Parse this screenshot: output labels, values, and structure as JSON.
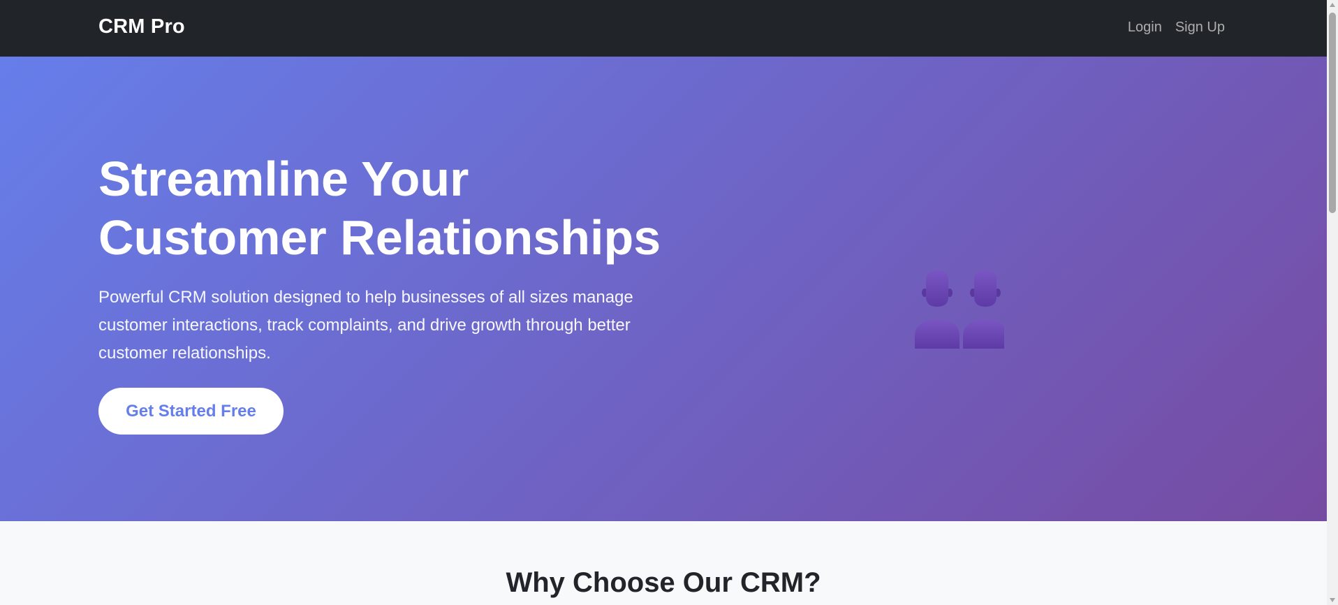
{
  "navbar": {
    "brand": "CRM Pro",
    "links": [
      "Login",
      "Sign Up"
    ]
  },
  "hero": {
    "title_line1": "Streamline Your",
    "title_line2": "Customer Relationships",
    "description": "Powerful CRM solution designed to help businesses of all sizes manage customer interactions, track complaints, and drive growth through better customer relationships.",
    "cta_label": "Get Started Free",
    "illustration": "people-icon"
  },
  "features": {
    "title": "Why Choose Our CRM?"
  },
  "colors": {
    "navbar_bg": "#212529",
    "gradient_start": "#667eea",
    "gradient_end": "#764ba2",
    "cta_text": "#667eea",
    "section_bg": "#f8f9fa"
  }
}
